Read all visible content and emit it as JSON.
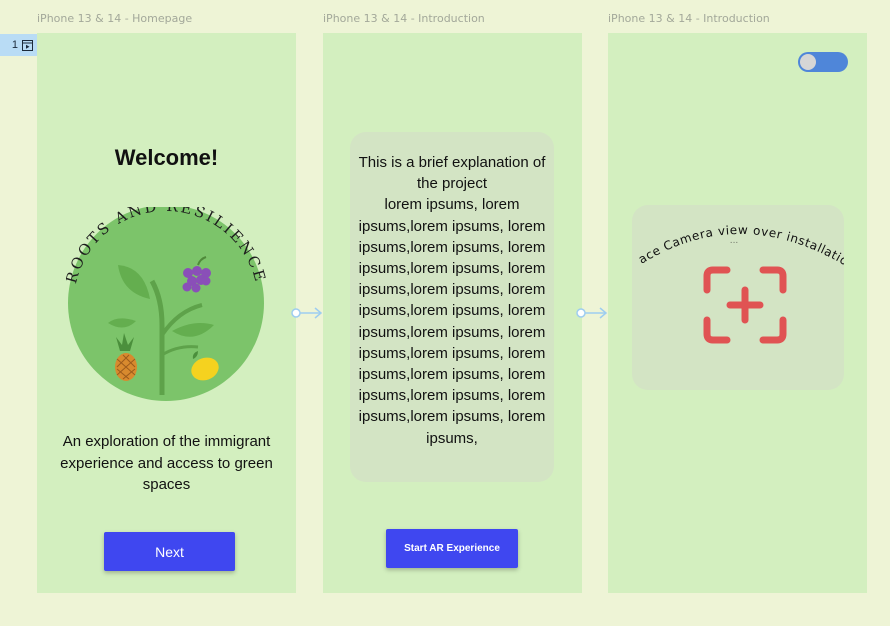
{
  "frames": [
    {
      "label": "iPhone 13 & 14 - Homepage"
    },
    {
      "label": "iPhone 13 & 14 - Introduction"
    },
    {
      "label": "iPhone 13 & 14 - Introduction"
    }
  ],
  "flow_tag": {
    "number": "1"
  },
  "homepage": {
    "title": "Welcome!",
    "logo_text": "ROOTS AND RESILIENCE",
    "description": "An exploration of the immigrant experience and access to  green spaces",
    "next_button": "Next"
  },
  "introduction": {
    "explanation": "This is a brief explanation of the project\nlorem ipsums, lorem ipsums,lorem ipsums, lorem ipsums,lorem ipsums, lorem ipsums,lorem ipsums, lorem ipsums,lorem ipsums, lorem ipsums,lorem ipsums, lorem ipsums,lorem ipsums, lorem ipsums,lorem ipsums, lorem ipsums,lorem ipsums, lorem ipsums,lorem ipsums, lorem ipsums,lorem ipsums, lorem ipsums,",
    "start_button": "Start AR Experience"
  },
  "camera": {
    "instruction": "Place Camera view over installation",
    "ellipsis": "...",
    "toggle_on": true,
    "icon": "camera-add-icon"
  },
  "colors": {
    "canvas": "#eef4d6",
    "frame": "#d3efbf",
    "button": "#3f47f0",
    "connector": "#9ecdf0",
    "camera_icon": "#e05353",
    "toggle": "#4f86d9"
  }
}
